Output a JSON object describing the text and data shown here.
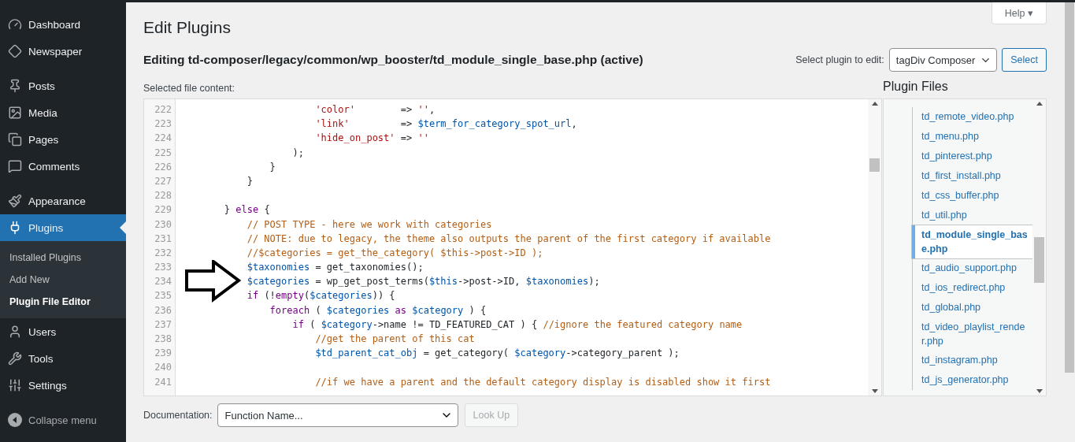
{
  "sidebar": {
    "groups": [
      [
        {
          "label": "Dashboard",
          "selected": false
        },
        {
          "label": "Newspaper",
          "selected": false
        }
      ],
      [
        {
          "label": "Posts",
          "selected": false
        },
        {
          "label": "Media",
          "selected": false
        },
        {
          "label": "Pages",
          "selected": false
        },
        {
          "label": "Comments",
          "selected": false
        }
      ],
      [
        {
          "label": "Appearance",
          "selected": false
        },
        {
          "label": "Plugins",
          "selected": true,
          "children": [
            {
              "label": "Installed Plugins",
              "selected": false
            },
            {
              "label": "Add New",
              "selected": false
            },
            {
              "label": "Plugin File Editor",
              "selected": true
            }
          ]
        },
        {
          "label": "Users",
          "selected": false
        },
        {
          "label": "Tools",
          "selected": false
        },
        {
          "label": "Settings",
          "selected": false
        }
      ]
    ],
    "collapse": "Collapse menu"
  },
  "help_tab": "Help ▾",
  "page_title": "Edit Plugins",
  "editing_heading": "Editing td-composer/legacy/common/wp_booster/td_module_single_base.php (active)",
  "plugin_select": {
    "label": "Select plugin to edit:",
    "value": "tagDiv Composer",
    "button": "Select"
  },
  "file_content_label": "Selected file content:",
  "code_lines": [
    {
      "number": "222",
      "tokens": [
        {
          "kind": "string",
          "text": "                        'color'"
        },
        {
          "kind": "plain",
          "text": "        => "
        },
        {
          "kind": "string",
          "text": "''"
        },
        {
          "kind": "plain",
          "text": ","
        }
      ]
    },
    {
      "number": "223",
      "tokens": [
        {
          "kind": "string",
          "text": "                        'link'"
        },
        {
          "kind": "plain",
          "text": "         => "
        },
        {
          "kind": "variable",
          "text": "$term_for_category_spot_url"
        },
        {
          "kind": "plain",
          "text": ","
        }
      ]
    },
    {
      "number": "224",
      "tokens": [
        {
          "kind": "string",
          "text": "                        'hide_on_post'"
        },
        {
          "kind": "plain",
          "text": " => "
        },
        {
          "kind": "string",
          "text": "''"
        }
      ]
    },
    {
      "number": "225",
      "tokens": [
        {
          "kind": "plain",
          "text": "                    );"
        }
      ]
    },
    {
      "number": "226",
      "tokens": [
        {
          "kind": "plain",
          "text": "                }"
        }
      ]
    },
    {
      "number": "227",
      "tokens": [
        {
          "kind": "plain",
          "text": "            }"
        }
      ]
    },
    {
      "number": "228"
    },
    {
      "number": "229",
      "tokens": [
        {
          "kind": "plain",
          "text": "        } "
        },
        {
          "kind": "keyword",
          "text": "else"
        },
        {
          "kind": "plain",
          "text": " {"
        }
      ]
    },
    {
      "number": "230",
      "tokens": [
        {
          "kind": "comment",
          "text": "            // POST TYPE - here we work with categories"
        }
      ]
    },
    {
      "number": "231",
      "tokens": [
        {
          "kind": "comment",
          "text": "            // NOTE: due to legacy, the theme also outputs the parent of the first category if available"
        }
      ]
    },
    {
      "number": "232",
      "tokens": [
        {
          "kind": "comment",
          "text": "            //$categories = get_the_category( $this->post->ID );"
        }
      ]
    },
    {
      "number": "233",
      "tokens": [
        {
          "kind": "variable",
          "text": "            $taxonomies"
        },
        {
          "kind": "plain",
          "text": " = get_taxonomies();"
        }
      ]
    },
    {
      "number": "234",
      "tokens": [
        {
          "kind": "variable",
          "text": "            $categories"
        },
        {
          "kind": "plain",
          "text": " = wp_get_post_terms("
        },
        {
          "kind": "variable",
          "text": "$this"
        },
        {
          "kind": "plain",
          "text": "->post->ID, "
        },
        {
          "kind": "variable",
          "text": "$taxonomies"
        },
        {
          "kind": "plain",
          "text": ");"
        }
      ]
    },
    {
      "number": "235",
      "tokens": [
        {
          "kind": "keyword",
          "text": "            if"
        },
        {
          "kind": "plain",
          "text": " (!"
        },
        {
          "kind": "keyword",
          "text": "empty"
        },
        {
          "kind": "plain",
          "text": "("
        },
        {
          "kind": "variable",
          "text": "$categories"
        },
        {
          "kind": "plain",
          "text": ")) {"
        }
      ]
    },
    {
      "number": "236",
      "tokens": [
        {
          "kind": "keyword",
          "text": "                foreach"
        },
        {
          "kind": "plain",
          "text": " ( "
        },
        {
          "kind": "variable",
          "text": "$categories"
        },
        {
          "kind": "keyword",
          "text": " as"
        },
        {
          "kind": "variable",
          "text": " $category"
        },
        {
          "kind": "plain",
          "text": " ) {"
        }
      ]
    },
    {
      "number": "237",
      "tokens": [
        {
          "kind": "keyword",
          "text": "                    if"
        },
        {
          "kind": "plain",
          "text": " ( "
        },
        {
          "kind": "variable",
          "text": "$category"
        },
        {
          "kind": "plain",
          "text": "->name != TD_FEATURED_CAT ) { "
        },
        {
          "kind": "comment",
          "text": "//ignore the featured category name"
        }
      ]
    },
    {
      "number": "238",
      "tokens": [
        {
          "kind": "comment",
          "text": "                        //get the parent of this cat"
        }
      ]
    },
    {
      "number": "239",
      "tokens": [
        {
          "kind": "variable",
          "text": "                        $td_parent_cat_obj"
        },
        {
          "kind": "plain",
          "text": " = get_category( "
        },
        {
          "kind": "variable",
          "text": "$category"
        },
        {
          "kind": "plain",
          "text": "->category_parent );"
        }
      ]
    },
    {
      "number": "240"
    },
    {
      "number": "241",
      "tokens": [
        {
          "kind": "comment",
          "text": "                        //if we have a parent and the default category display is disabled show it first"
        }
      ]
    }
  ],
  "plugin_files": {
    "title": "Plugin Files",
    "items": [
      {
        "label": "td_remote_video.php",
        "selected": false
      },
      {
        "label": "td_menu.php",
        "selected": false
      },
      {
        "label": "td_pinterest.php",
        "selected": false
      },
      {
        "label": "td_first_install.php",
        "selected": false
      },
      {
        "label": "td_css_buffer.php",
        "selected": false
      },
      {
        "label": "td_util.php",
        "selected": false
      },
      {
        "label": "td_module_single_base.php",
        "selected": true
      },
      {
        "label": "td_audio_support.php",
        "selected": false
      },
      {
        "label": "td_ios_redirect.php",
        "selected": false
      },
      {
        "label": "td_global.php",
        "selected": false
      },
      {
        "label": "td_video_playlist_render.php",
        "selected": false
      },
      {
        "label": "td_instagram.php",
        "selected": false
      },
      {
        "label": "td_js_generator.php",
        "selected": false
      }
    ]
  },
  "documentation": {
    "label": "Documentation:",
    "placeholder": "Function Name...",
    "button": "Look Up",
    "button_disabled": true
  }
}
